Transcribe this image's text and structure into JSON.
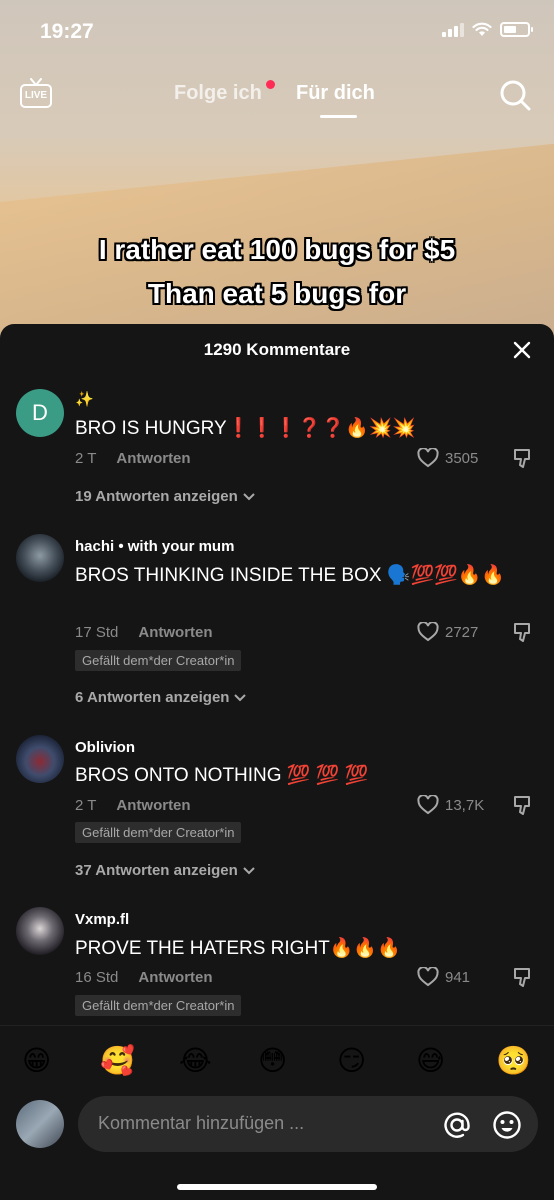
{
  "status": {
    "time": "19:27"
  },
  "nav": {
    "live_label": "LIVE",
    "tab_following": "Folge ich",
    "tab_for_you": "Für dich"
  },
  "video": {
    "caption_line1": "I rather eat 100 bugs for $5",
    "caption_line2": "Than eat 5 bugs for"
  },
  "sheet": {
    "title": "1290 Kommentare"
  },
  "comments": [
    {
      "avatar_letter": "D",
      "name": "✨",
      "text": "BRO IS HUNGRY❗❗❗❓❓🔥💥💥",
      "time": "2 T",
      "reply": "Antworten",
      "likes": "3505",
      "replies": "19 Antworten anzeigen"
    },
    {
      "name": "hachi • with your mum",
      "text": "BROS THINKING INSIDE THE BOX 🗣️💯💯🔥🔥",
      "time": "17 Std",
      "reply": "Antworten",
      "likes": "2727",
      "badge": "Gefällt dem*der Creator*in",
      "replies": "6 Antworten anzeigen"
    },
    {
      "name": "Oblivion",
      "text": "BROS ONTO NOTHING 💯 💯 💯",
      "time": "2 T",
      "reply": "Antworten",
      "likes": "13,7K",
      "badge": "Gefällt dem*der Creator*in",
      "replies": "37 Antworten anzeigen"
    },
    {
      "name": "Vxmp.fl",
      "text": "PROVE THE HATERS RIGHT🔥🔥🔥",
      "time": "16 Std",
      "reply": "Antworten",
      "likes": "941",
      "badge": "Gefällt dem*der Creator*in"
    }
  ],
  "emojis": [
    "😁",
    "🥰",
    "😂",
    "😳",
    "😏",
    "😅",
    "🥺"
  ],
  "input": {
    "placeholder": "Kommentar hinzufügen ..."
  }
}
